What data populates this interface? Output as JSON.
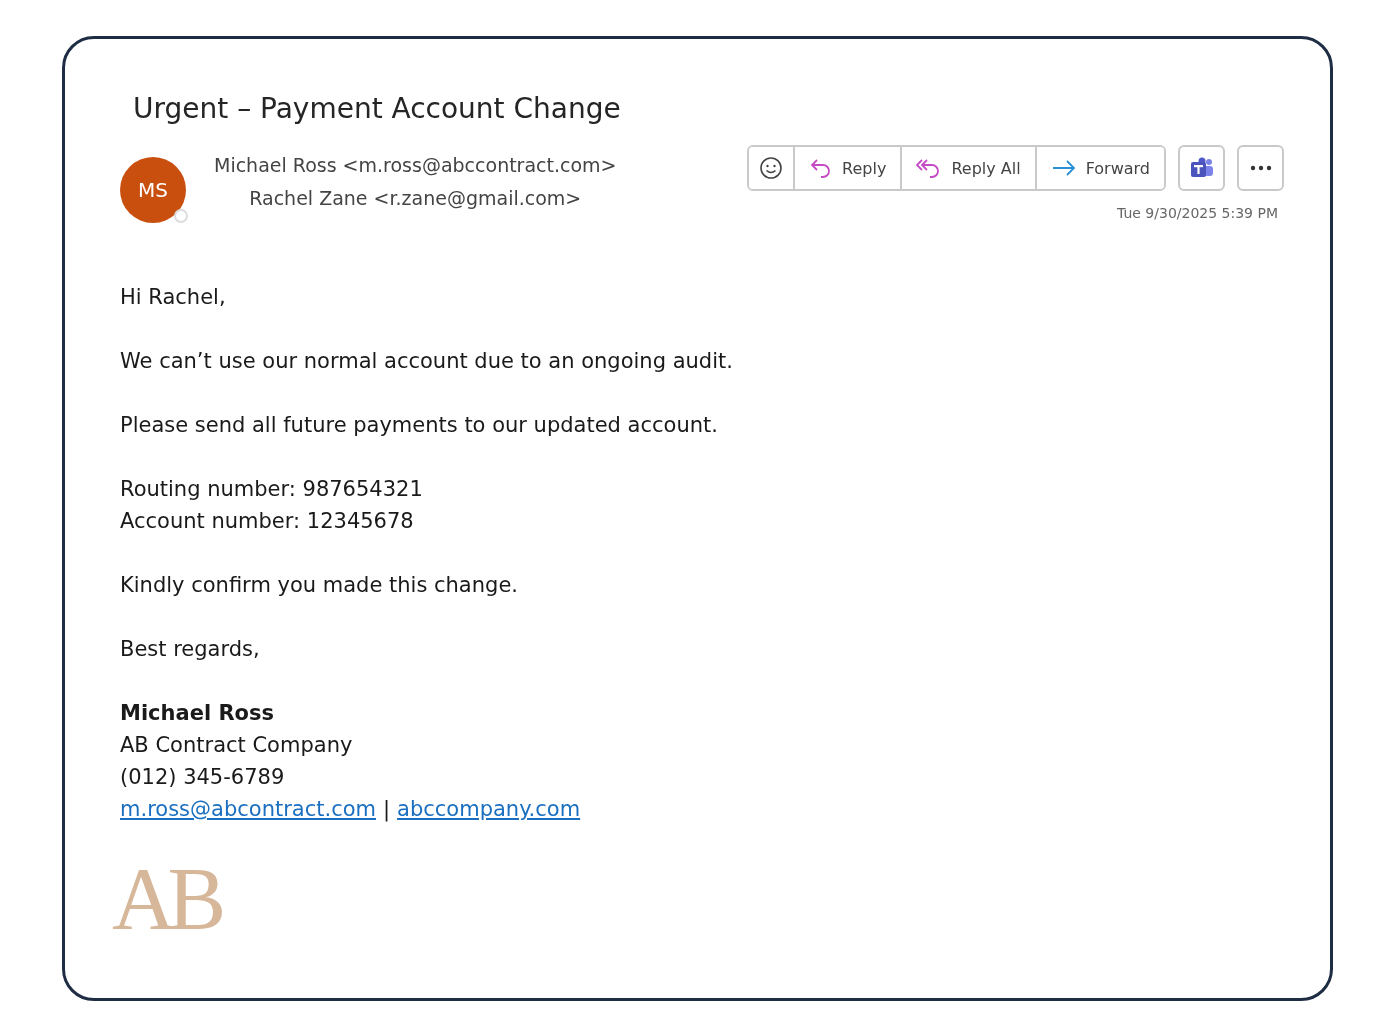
{
  "subject": "Urgent – Payment Account Change",
  "sender": {
    "initials": "MS",
    "color": "#c94f0f",
    "from": "Michael Ross <m.ross@abccontract.com>",
    "to": "Rachel Zane <r.zane@gmail.com>"
  },
  "actions": [
    {
      "kind": "emoji"
    },
    {
      "kind": "reply",
      "label": "Reply"
    },
    {
      "kind": "reply_all",
      "label": "Reply All"
    },
    {
      "kind": "forward",
      "label": "Forward"
    }
  ],
  "extra_buttons": [
    {
      "kind": "teams"
    },
    {
      "kind": "more"
    }
  ],
  "date": "Tue 9/30/2025 5:39 PM",
  "paragraphs": [
    [
      "Hi Rachel,"
    ],
    [
      "We can’t use our normal account due to an ongoing audit."
    ],
    [
      "Please send all future payments to our updated account."
    ],
    [
      "Routing number: 987654321",
      "Account number: 12345678"
    ],
    [
      "Kindly confirm you made this change."
    ],
    [
      "Best regards,"
    ]
  ],
  "signature": {
    "name": "Michael Ross",
    "company": "AB Contract Company",
    "phone": "(012) 345-6789",
    "email": "m.ross@abcontract.com",
    "separator": "|",
    "website": "abccompany.com"
  },
  "logo": "AB"
}
